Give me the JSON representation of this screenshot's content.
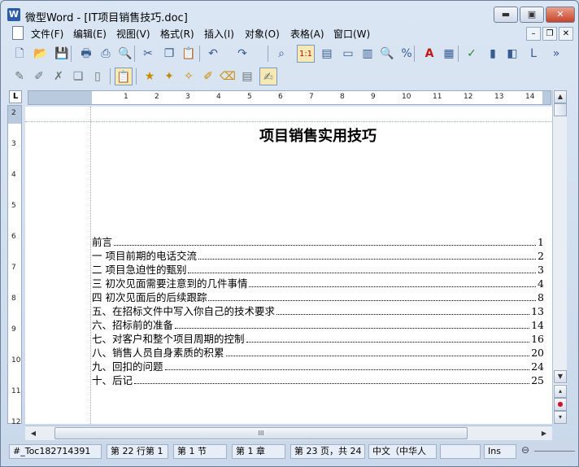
{
  "window": {
    "app_icon_letter": "W",
    "title": "微型Word - [IT项目销售技巧.doc]",
    "controls": {
      "minimize": "▬",
      "maximize": "▣",
      "close": "✕"
    }
  },
  "menubar": {
    "items": [
      "文件(F)",
      "编辑(E)",
      "视图(V)",
      "格式(R)",
      "插入(I)",
      "对象(O)",
      "表格(A)",
      "窗口(W)"
    ],
    "mdi": {
      "minimize": "–",
      "restore": "❐",
      "close": "✕"
    }
  },
  "toolbar1": {
    "icons": [
      {
        "name": "new-doc-icon",
        "glyph": "🗋"
      },
      {
        "name": "open-folder-icon",
        "glyph": "📂"
      },
      {
        "name": "save-icon",
        "glyph": "💾"
      },
      {
        "name": "print-icon",
        "glyph": "🖶"
      },
      {
        "name": "pdf-icon",
        "glyph": "⎙"
      },
      {
        "name": "print-preview-icon",
        "glyph": "🔍"
      },
      {
        "name": "cut-icon",
        "glyph": "✂"
      },
      {
        "name": "copy-icon",
        "glyph": "❐"
      },
      {
        "name": "paste-icon",
        "glyph": "📋"
      },
      {
        "name": "undo-icon",
        "glyph": "↶"
      },
      {
        "name": "redo-icon",
        "glyph": "↷"
      },
      {
        "name": "find-icon",
        "glyph": "⌕"
      },
      {
        "name": "zoom-100-icon",
        "glyph": "1:1"
      },
      {
        "name": "page-view-icon",
        "glyph": "▤"
      },
      {
        "name": "normal-view-icon",
        "glyph": "▭"
      },
      {
        "name": "two-page-icon",
        "glyph": "▥"
      },
      {
        "name": "magnifier-icon",
        "glyph": "🔍"
      },
      {
        "name": "zoom-percent-icon",
        "glyph": "%"
      },
      {
        "name": "font-icon",
        "glyph": "A"
      },
      {
        "name": "text-box-icon",
        "glyph": "▦"
      },
      {
        "name": "spell-check-icon",
        "glyph": "✓"
      },
      {
        "name": "chart-icon",
        "glyph": "▮"
      },
      {
        "name": "object-icon",
        "glyph": "◧"
      },
      {
        "name": "l-icon",
        "glyph": "L"
      },
      {
        "name": "more-icon",
        "glyph": "»"
      }
    ]
  },
  "toolbar2": {
    "icons": [
      {
        "name": "edit-mark-icon",
        "glyph": "✎"
      },
      {
        "name": "edit-pen-icon",
        "glyph": "✐"
      },
      {
        "name": "delete-mark-icon",
        "glyph": "✗"
      },
      {
        "name": "copy-doc-icon",
        "glyph": "❏"
      },
      {
        "name": "doc-outline-icon",
        "glyph": "▯"
      },
      {
        "name": "clipboard-icon",
        "glyph": "📋"
      },
      {
        "name": "star-icon",
        "glyph": "★"
      },
      {
        "name": "star-pen-icon",
        "glyph": "✦"
      },
      {
        "name": "brush-icon",
        "glyph": "✧"
      },
      {
        "name": "marker-icon",
        "glyph": "✐"
      },
      {
        "name": "eraser-icon",
        "glyph": "⌫"
      },
      {
        "name": "notes-icon",
        "glyph": "▤"
      },
      {
        "name": "review-icon",
        "glyph": "✍"
      }
    ]
  },
  "ruler": {
    "tab_marker": "L",
    "h_numbers": [
      "1",
      "2",
      "3",
      "4",
      "5",
      "6",
      "7",
      "8",
      "9",
      "10",
      "11",
      "12",
      "13",
      "14"
    ],
    "v_numbers": [
      "2",
      "3",
      "4",
      "5",
      "6",
      "7",
      "8",
      "9",
      "10",
      "11",
      "12"
    ]
  },
  "document": {
    "title": "项目销售实用技巧",
    "toc": [
      {
        "text": "前言",
        "page": "1"
      },
      {
        "text": "一  项目前期的电话交流",
        "page": "2"
      },
      {
        "text": "二  项目急迫性的甄别",
        "page": "3"
      },
      {
        "text": "三  初次见面需要注意到的几件事情",
        "page": "4"
      },
      {
        "text": "四  初次见面后的后续跟踪",
        "page": "8"
      },
      {
        "text": "五、在招标文件中写入你自己的技术要求",
        "page": "13"
      },
      {
        "text": "六、招标前的准备",
        "page": "14"
      },
      {
        "text": "七、对客户和整个项目周期的控制",
        "page": "16"
      },
      {
        "text": "八、销售人员自身素质的积累",
        "page": "20"
      },
      {
        "text": "九、回扣的问题",
        "page": "24"
      },
      {
        "text": "十、后记",
        "page": "25"
      }
    ]
  },
  "scrollbar": {
    "up": "▲",
    "down": "▼",
    "left": "◀",
    "right": "▶",
    "thumb_grip": "III",
    "prev_page": "▴",
    "browse_object": "●",
    "next_page": "▾"
  },
  "statusbar": {
    "bookmark": "#_Toc182714391",
    "line_col": "第 22 行第 1",
    "section": "第 1 节",
    "chapter": "第 1 章",
    "pages": "第 23 页，共 24",
    "language": "中文（中华人",
    "empty": "",
    "mode": "Ins",
    "zoom_icon": "⊖"
  },
  "colors": {
    "accent": "#2b5ca8",
    "close_button": "#c7432a",
    "chrome": "#cfdcec"
  }
}
